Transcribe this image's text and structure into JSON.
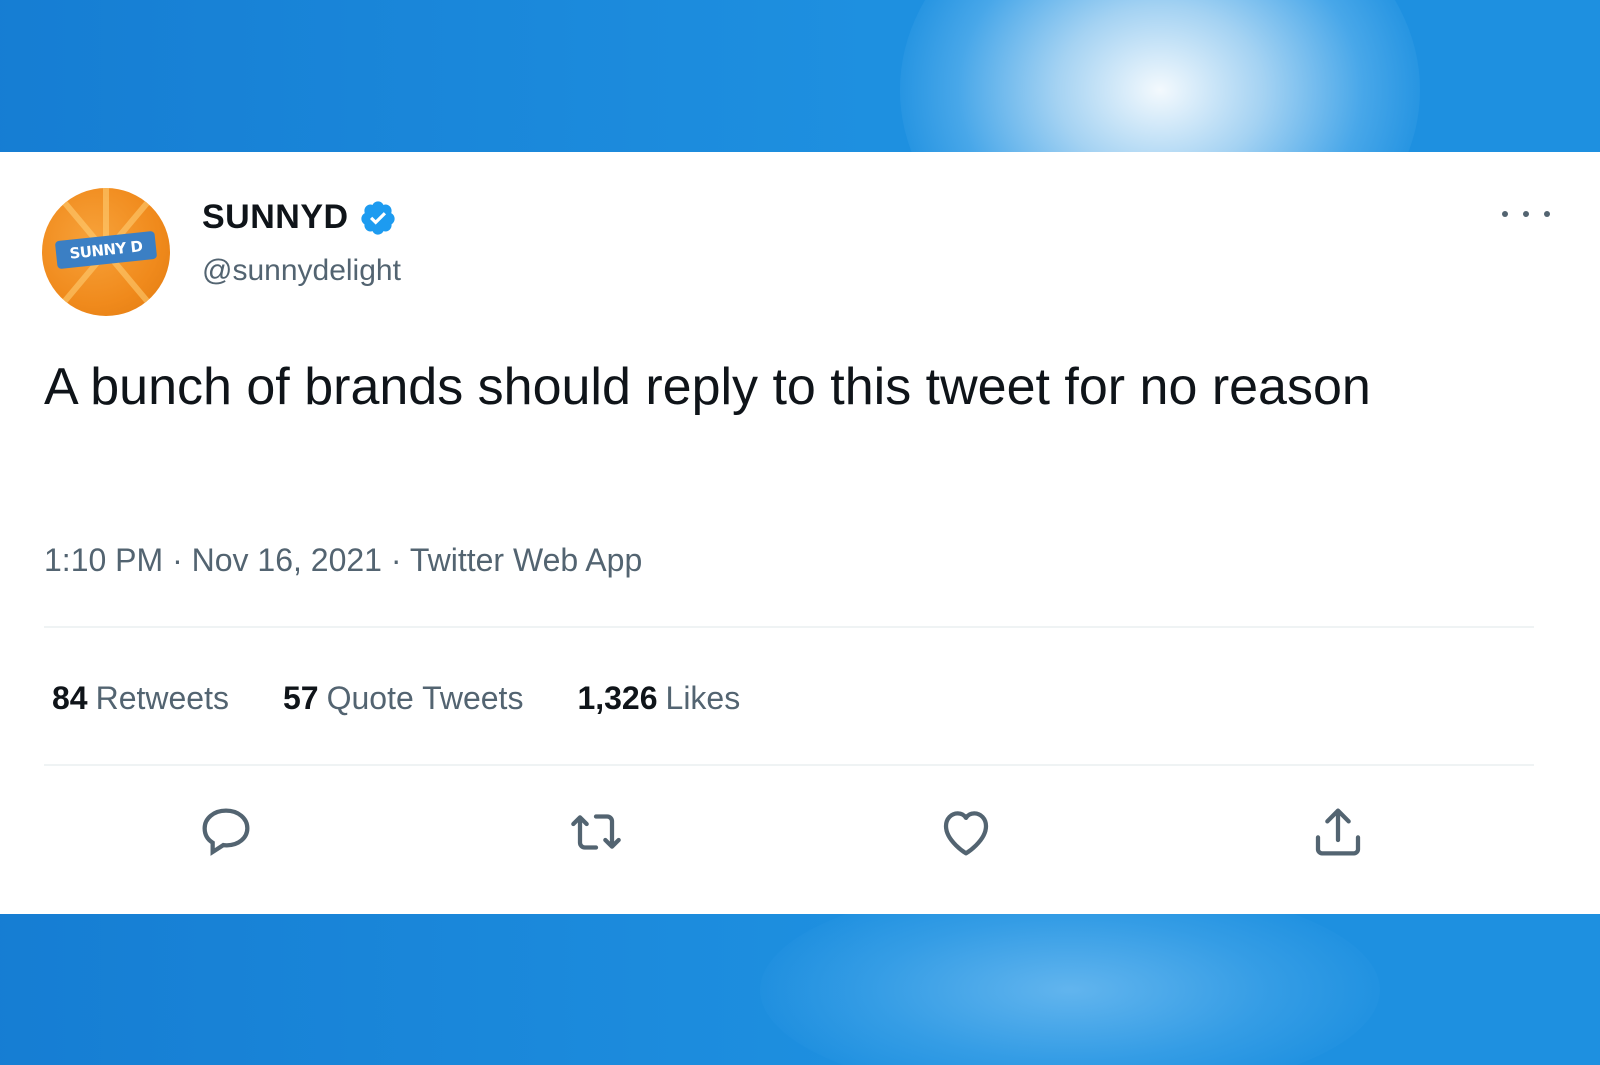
{
  "tweet": {
    "display_name": "SUNNYD",
    "handle": "@sunnydelight",
    "avatar_text": "SUNNY D",
    "text": "A bunch of brands should reply to this tweet for no reason",
    "time": "1:10 PM",
    "date": "Nov 16, 2021",
    "source": "Twitter Web App",
    "separator": "·",
    "verified": true
  },
  "stats": {
    "retweets_count": "84",
    "retweets_label": "Retweets",
    "quotes_count": "57",
    "quotes_label": "Quote Tweets",
    "likes_count": "1,326",
    "likes_label": "Likes"
  },
  "icons": {
    "verified": "verified-badge-icon",
    "more": "more-options-icon",
    "reply": "reply-icon",
    "retweet": "retweet-icon",
    "like": "heart-icon",
    "share": "share-icon"
  },
  "colors": {
    "background_sky": "#1e90e0",
    "verified_blue": "#1d9bf0",
    "text_primary": "#0f1419",
    "text_secondary": "#536471",
    "avatar_orange": "#f08a1c"
  }
}
